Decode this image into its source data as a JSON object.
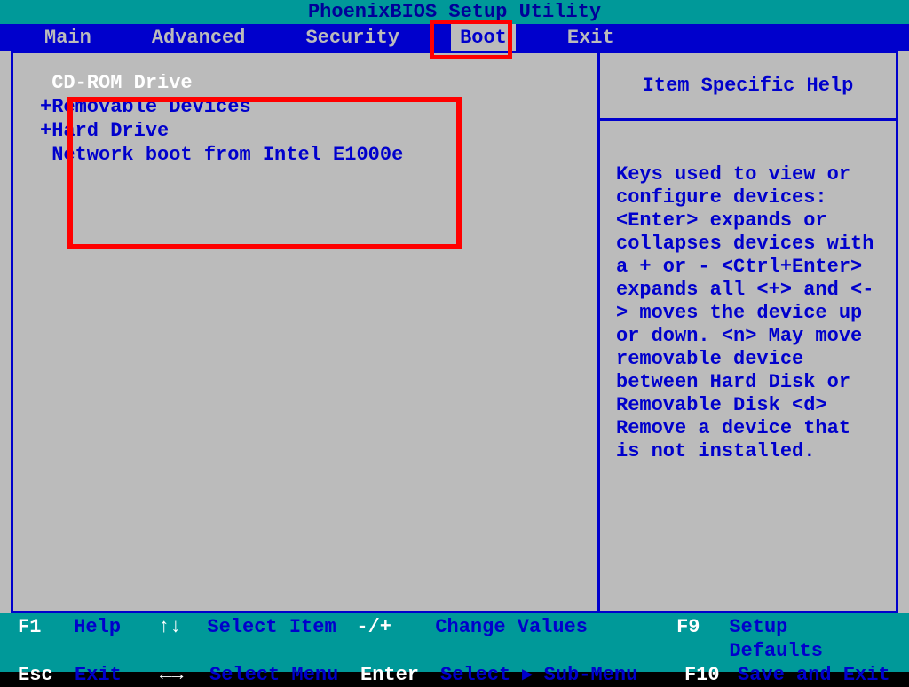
{
  "title": "PhoenixBIOS Setup Utility",
  "menu": {
    "items": [
      "Main",
      "Advanced",
      "Security",
      "Boot",
      "Exit"
    ],
    "active_index": 3
  },
  "boot_order": [
    {
      "prefix": " ",
      "label": "CD-ROM Drive",
      "selected": true
    },
    {
      "prefix": "+",
      "label": "Removable Devices",
      "selected": false
    },
    {
      "prefix": "+",
      "label": "Hard Drive",
      "selected": false
    },
    {
      "prefix": " ",
      "label": "Network boot from Intel E1000e",
      "selected": false
    }
  ],
  "help": {
    "title": "Item Specific Help",
    "body": "Keys used to view or configure devices:\n<Enter> expands or collapses devices with a + or -\n<Ctrl+Enter> expands all\n<+> and <-> moves the device up or down.\n<n> May move removable device between Hard Disk or Removable Disk\n<d> Remove a device that is not installed."
  },
  "footer": {
    "row1": {
      "k1": "F1",
      "l1": "Help",
      "a1": "↑↓",
      "ac1": "Select Item",
      "k2": "-/+",
      "ac2": "Change Values",
      "k3": "F9",
      "ac3": "Setup Defaults"
    },
    "row2": {
      "k1": "Esc",
      "l1": "Exit",
      "a1": "←→",
      "ac1": "Select Menu",
      "k2": "Enter",
      "ac2a": "Select",
      "ac2b": "Sub-Menu",
      "k3": "F10",
      "ac3": "Save and Exit"
    }
  }
}
